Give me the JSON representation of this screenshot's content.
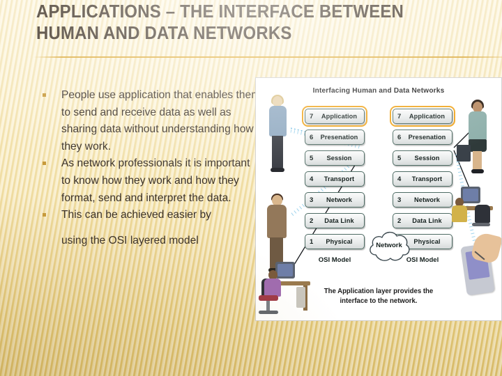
{
  "slide": {
    "title": "Applications – The Interface Between\nHuman and Data Networks",
    "accent_color": "#d6a028",
    "bullet_color": "#c79a3c",
    "title_color": "#3b2f22",
    "body_color": "#3a3129",
    "background_colors": [
      "#fdf3d2",
      "#f6e5ae",
      "#d9bc6a"
    ]
  },
  "body": {
    "bullets": [
      "People use application that enables them to send and receive data as well as sharing data without understanding how they work.",
      "As network professionals it is important to know how they work and how they format, send and interpret the data.",
      "This can be achieved easier by"
    ],
    "continuation": "using the OSI layered model"
  },
  "picture": {
    "title": "Interfacing Human and Data Networks",
    "caption": "The Application layer provides the\ninterface to the network.",
    "cloud_label": "Network",
    "stack_label": "OSI Model",
    "highlight_color": "#f0a51e",
    "left_stack": {
      "label": "OSI Model",
      "layers": [
        {
          "num": "7",
          "name": "Application",
          "highlight": true
        },
        {
          "num": "6",
          "name": "Presenation",
          "highlight": false
        },
        {
          "num": "5",
          "name": "Session",
          "highlight": false
        },
        {
          "num": "4",
          "name": "Transport",
          "highlight": false
        },
        {
          "num": "3",
          "name": "Network",
          "highlight": false
        },
        {
          "num": "2",
          "name": "Data Link",
          "highlight": false
        },
        {
          "num": "1",
          "name": "Physical",
          "highlight": false
        }
      ]
    },
    "right_stack": {
      "label": "OSI Model",
      "layers": [
        {
          "num": "7",
          "name": "Application",
          "highlight": true
        },
        {
          "num": "6",
          "name": "Presenation",
          "highlight": false
        },
        {
          "num": "5",
          "name": "Session",
          "highlight": false
        },
        {
          "num": "4",
          "name": "Transport",
          "highlight": false
        },
        {
          "num": "3",
          "name": "Network",
          "highlight": false
        },
        {
          "num": "2",
          "name": "Data Link",
          "highlight": false
        },
        {
          "num": "1",
          "name": "Physical",
          "highlight": false
        }
      ]
    }
  }
}
